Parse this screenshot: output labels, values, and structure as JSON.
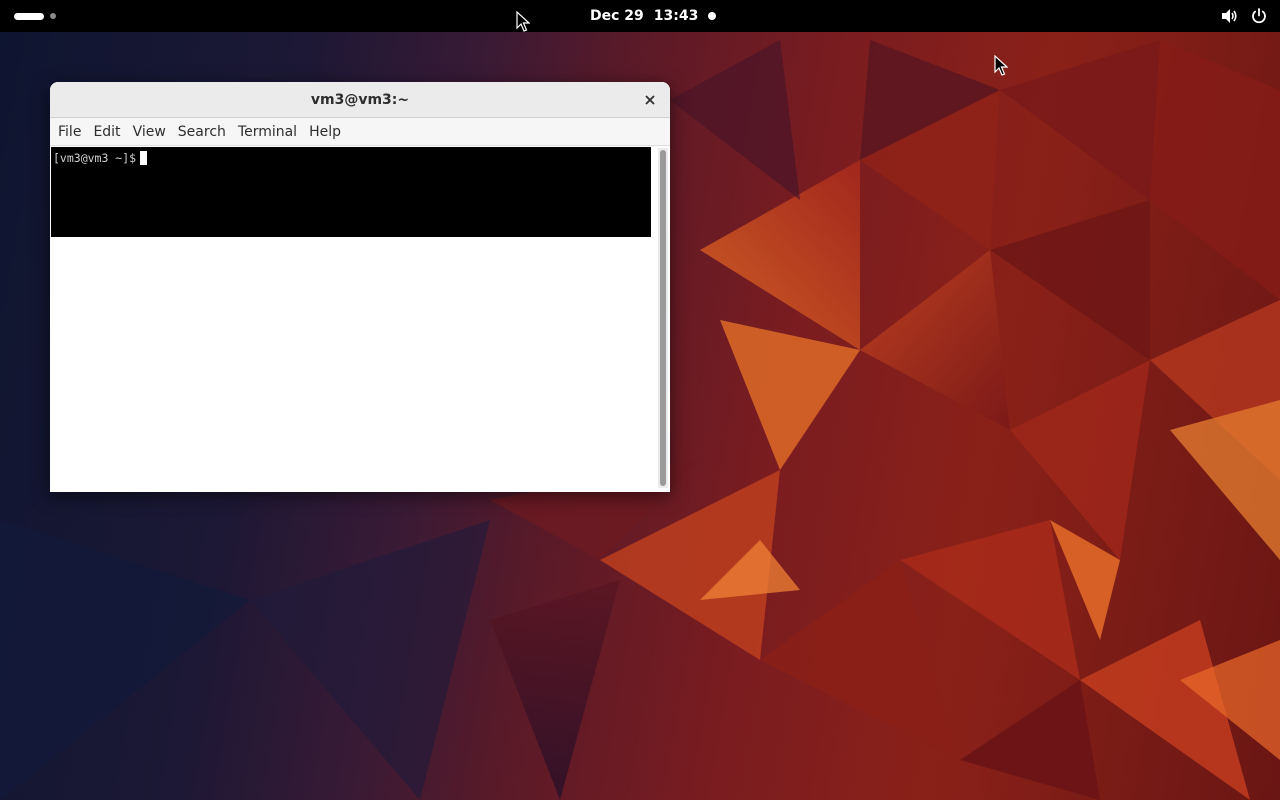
{
  "topbar": {
    "activities_icon": "activities-pill-icon",
    "clock": {
      "date": "Dec 29",
      "time": "13:43"
    },
    "notification_icon": "notification-dot-icon",
    "tray": {
      "volume_icon": "speaker-volume-icon",
      "power_icon": "power-icon"
    }
  },
  "terminal": {
    "title": "vm3@vm3:~",
    "close_icon": "close-icon",
    "menu": [
      "File",
      "Edit",
      "View",
      "Search",
      "Terminal",
      "Help"
    ],
    "prompt": "[vm3@vm3 ~]$",
    "background_color": "#000000",
    "foreground_color": "#d0d0d0"
  },
  "pointers": [
    "mouse-pointer-icon",
    "mouse-pointer-icon"
  ],
  "colors": {
    "topbar": "#000000",
    "wallpaper_red": "#8a2118",
    "wallpaper_orange": "#d85a20",
    "wallpaper_dark": "#0e1530"
  }
}
